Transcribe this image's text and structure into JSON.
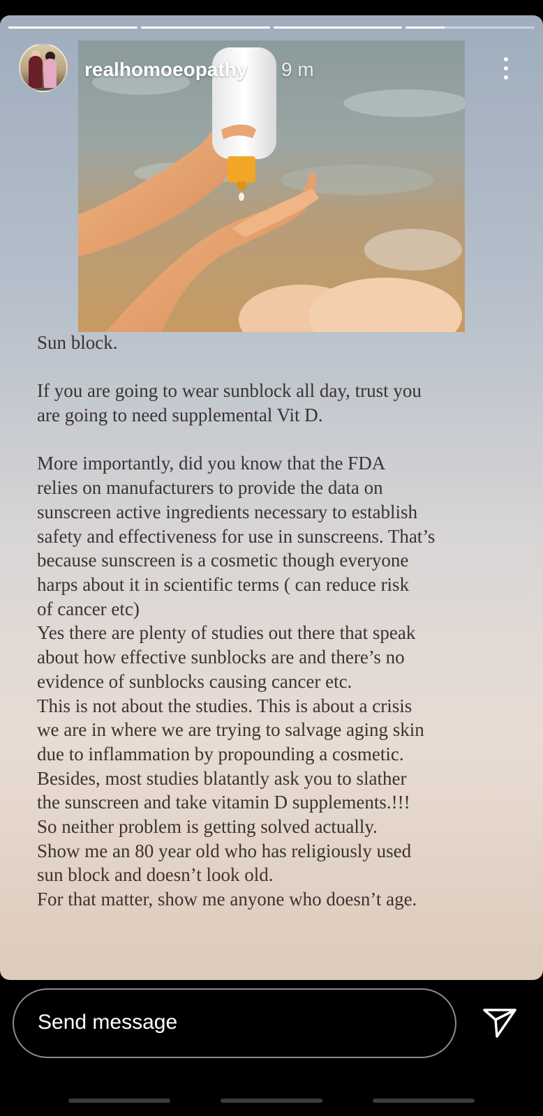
{
  "story": {
    "progress": [
      1,
      1,
      1,
      0.3
    ],
    "username": "realhomoeopathy",
    "time_ago": "9 m",
    "text": {
      "title": "Sun block.",
      "paragraph1": [
        "If you are going to wear sunblock all day, trust you",
        "are going to need supplemental Vit D."
      ],
      "paragraph2": [
        "More importantly, did you know that the FDA",
        "relies on manufacturers to provide the data on",
        "sunscreen active ingredients necessary to establish",
        "safety and effectiveness for use in sunscreens. That’s",
        "because sunscreen is a cosmetic though everyone",
        "harps about it in scientific terms ( can reduce risk",
        "of cancer etc)",
        "Yes there are plenty of studies out there that speak",
        "about how effective sunblocks are and there’s no",
        "evidence of sunblocks causing cancer etc.",
        "This is not about the studies. This is about a crisis",
        "we are in where we are trying to salvage aging skin",
        "due to inflammation by propounding a cosmetic.",
        "Besides, most studies blatantly ask you to slather",
        "the sunscreen and take vitamin D supplements.!!!",
        "So neither problem is getting solved actually.",
        "Show me an 80 year old who has religiously used",
        "sun block and doesn’t look old.",
        "For that matter, show me anyone who doesn’t age."
      ]
    }
  },
  "reply": {
    "placeholder": "Send message"
  },
  "icons": {
    "more": "more-vertical-icon",
    "send": "send-icon"
  }
}
